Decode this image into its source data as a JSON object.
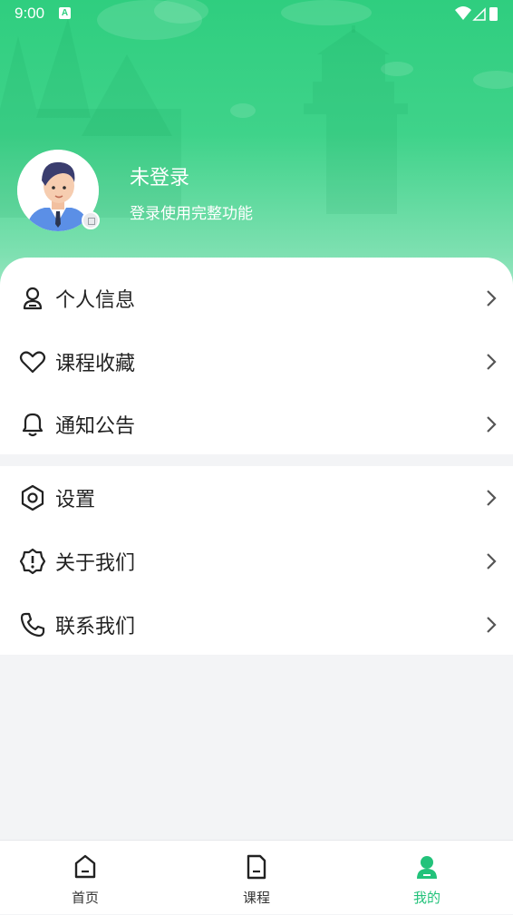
{
  "status_bar": {
    "time": "9:00",
    "notification_icon": "A"
  },
  "profile": {
    "name": "未登录",
    "subtitle": "登录使用完整功能"
  },
  "menu_group_1": [
    {
      "label": "个人信息",
      "icon": "person-icon"
    },
    {
      "label": "课程收藏",
      "icon": "heart-icon"
    },
    {
      "label": "通知公告",
      "icon": "bell-icon"
    }
  ],
  "menu_group_2": [
    {
      "label": "设置",
      "icon": "settings-icon"
    },
    {
      "label": "关于我们",
      "icon": "info-badge-icon"
    },
    {
      "label": "联系我们",
      "icon": "phone-icon"
    }
  ],
  "tabs": [
    {
      "label": "首页",
      "icon": "home-icon",
      "active": false
    },
    {
      "label": "课程",
      "icon": "course-icon",
      "active": false
    },
    {
      "label": "我的",
      "icon": "profile-icon",
      "active": true
    }
  ],
  "colors": {
    "accent": "#22c27a",
    "header_top": "#2fce7f",
    "background": "#f3f4f6"
  }
}
